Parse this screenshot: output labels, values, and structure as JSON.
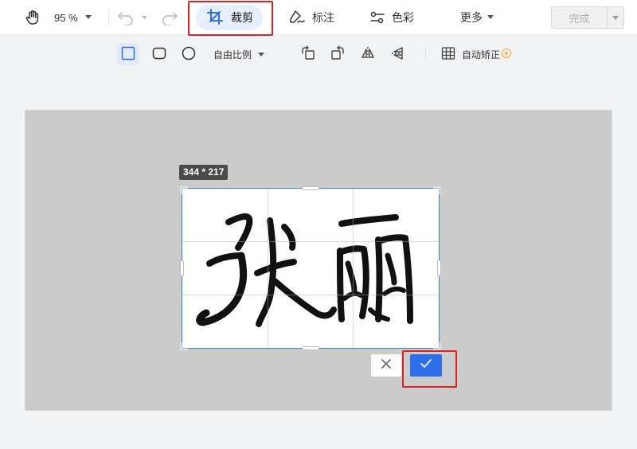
{
  "toolbar": {
    "zoom_value": "95 %",
    "crop_label": "裁剪",
    "mark_label": "标注",
    "color_label": "色彩",
    "more_label": "更多",
    "done_label": "完成"
  },
  "subtoolbar": {
    "ratio_label": "自由比例",
    "auto_fix_label": "自动矫正"
  },
  "crop": {
    "size_label": "344 * 217"
  },
  "colors": {
    "accent": "#2f6eeb",
    "active_bg": "#e6efff",
    "highlight": "#e02020",
    "canvas_bg": "#cbcbcb"
  }
}
